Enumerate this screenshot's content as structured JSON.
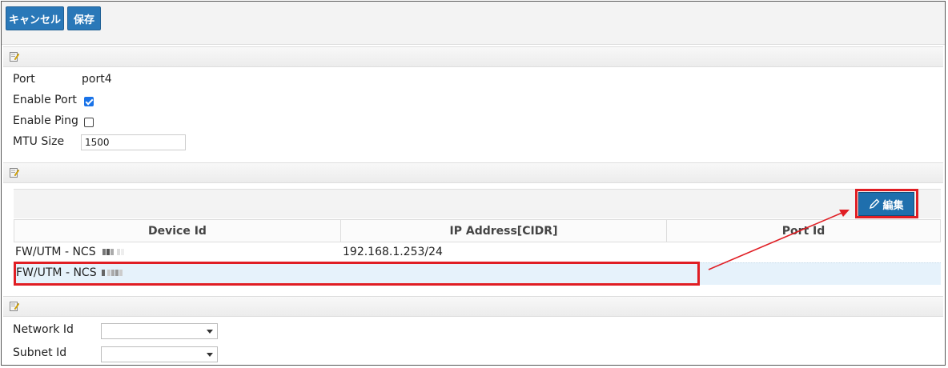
{
  "toolbar": {
    "cancel_label": "キャンセル",
    "save_label": "保存"
  },
  "port_section": {
    "port_label": "Port",
    "port_value": "port4",
    "enable_port_label": "Enable Port",
    "enable_port_checked": true,
    "enable_ping_label": "Enable Ping",
    "enable_ping_checked": false,
    "mtu_label": "MTU Size",
    "mtu_value": "1500"
  },
  "device_section": {
    "edit_label": "編集",
    "columns": [
      "Device Id",
      "IP Address[CIDR]",
      "Port Id"
    ],
    "rows": [
      {
        "device_id": "FW/UTM - NCS",
        "ip": "192.168.1.253/24",
        "port_id": ""
      },
      {
        "device_id": "FW/UTM - NCS",
        "ip": "",
        "port_id": ""
      }
    ]
  },
  "network_section": {
    "network_label": "Network Id",
    "network_value": "",
    "subnet_label": "Subnet Id",
    "subnet_value": ""
  },
  "colors": {
    "accent": "#2a78b8",
    "highlight_row": "#e6f2fb",
    "annotation_red": "#e01e24"
  }
}
